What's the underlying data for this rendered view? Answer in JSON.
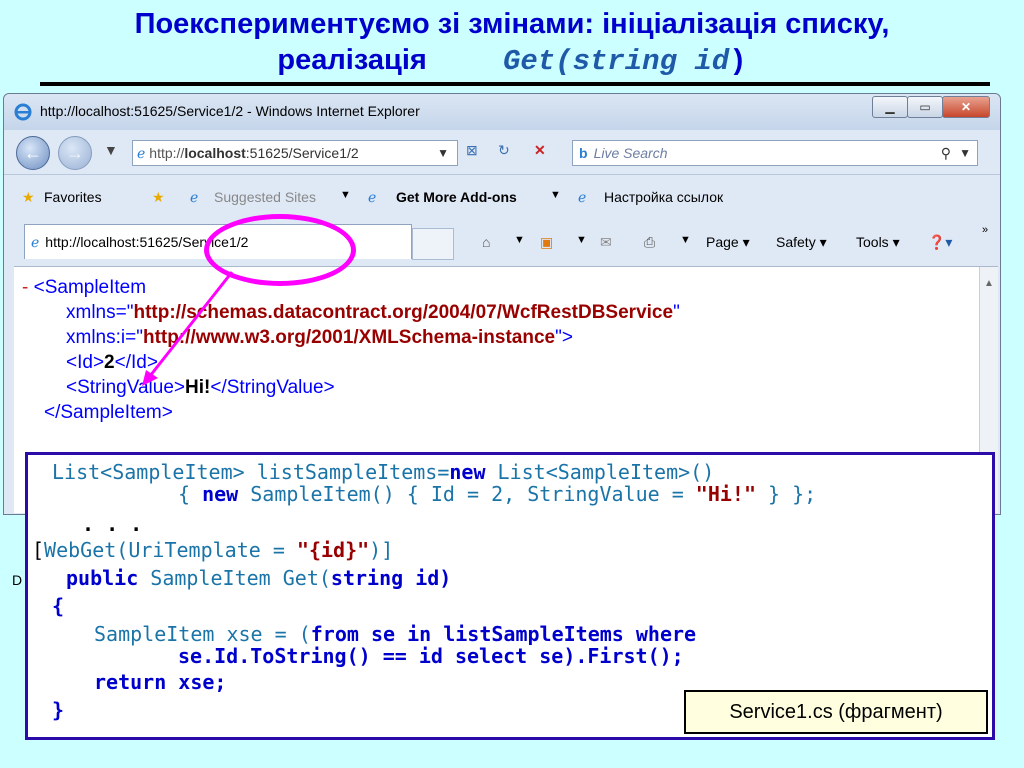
{
  "slide": {
    "title_line1": "Поекспериментуємо зі змінами: ініціалізація списку,",
    "title_line2_text": "реалізація",
    "title_code_get": "Get(",
    "title_code_arg": "string id",
    "title_code_close": ")"
  },
  "browser": {
    "window_title": "http://localhost:51625/Service1/2 - Windows Internet Explorer",
    "address_prefix": "http://",
    "address_host": "localhost",
    "address_rest": ":51625/Service1/2",
    "search_placeholder": "Live Search",
    "favorites_label": "Favorites",
    "suggested_sites": "Suggested Sites",
    "get_addons": "Get More Add-ons",
    "links_setting": "Настройка ссылок",
    "tab_title": "http://localhost:51625/Service1/2",
    "menu_page": "Page",
    "menu_safety": "Safety",
    "menu_tools": "Tools",
    "status_left": "D",
    "xml": {
      "open_tag": "<SampleItem",
      "collapse": "-",
      "xmlns_attr": "xmlns=\"",
      "xmlns_value": "http://schemas.datacontract.org/2004/07/WcfRestDBService",
      "xmlns_close": "\"",
      "xmlnsi_attr": "xmlns:i=\"",
      "xmlnsi_value": "http://www.w3.org/2001/XMLSchema-instance",
      "xmlnsi_close": "\">",
      "id_open": "<Id>",
      "id_value": "2",
      "id_close": "</Id>",
      "sv_open": "<StringValue>",
      "sv_value": "Hi!",
      "sv_close": "</StringValue>",
      "close_tag": "</SampleItem>"
    }
  },
  "code": {
    "l1a": "List<SampleItem> listSampleItems=",
    "l1b": "new",
    "l1c": " List<SampleItem>()",
    "l2a": "{ ",
    "l2b": "new",
    "l2c": " SampleItem() { Id = 2, StringValue = ",
    "l2d": "\"Hi!\"",
    "l2e": " } };",
    "l3": ". . .",
    "l4a": "[",
    "l4b": "WebGet(UriTemplate = ",
    "l4c": "\"{id}\"",
    "l4d": ")]",
    "l5a": "public",
    "l5b": " SampleItem Get(",
    "l5c": "string id)",
    "l6": "{",
    "l7a": "SampleItem xse = (",
    "l7b": "from se in listSampleItems where",
    "l8": "se.Id.ToString() == id select se).First();",
    "l9": "return xse;",
    "l10": "}",
    "note": "Service1.cs (фрагмент)"
  }
}
